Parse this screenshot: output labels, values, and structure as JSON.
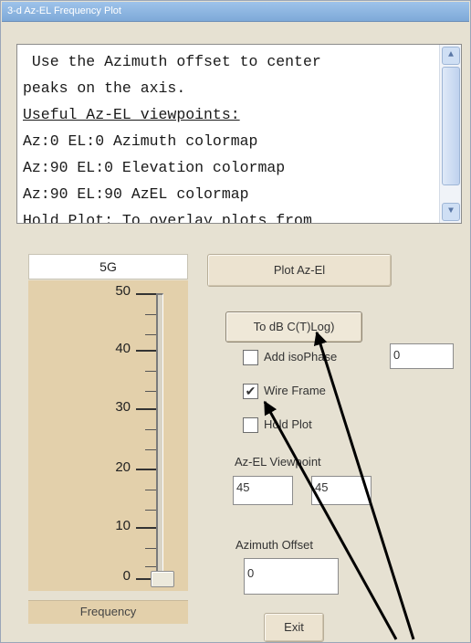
{
  "window": {
    "title": "3-d Az-EL Frequency Plot"
  },
  "info_text": {
    "lines": [
      " Use the Azimuth offset to center",
      "peaks on the axis.",
      "Useful Az-EL viewpoints:",
      "Az:0 EL:0 Azimuth colormap",
      "Az:90 EL:0 Elevation colormap",
      "Az:90 EL:90 AzEL colormap",
      "Hold Plot: To overlay plots from"
    ]
  },
  "slider": {
    "value_label": "5G",
    "caption": "Frequency",
    "ticks": [
      "50",
      "40",
      "30",
      "20",
      "10",
      "0"
    ],
    "min": 0,
    "max": 50,
    "value": 0
  },
  "buttons": {
    "plot": "Plot Az-El",
    "to_db": "To dB C(T)Log)",
    "exit": "Exit"
  },
  "checkboxes": {
    "axis_phase": {
      "label": "Add isoPhase",
      "checked": false
    },
    "wire_frame": {
      "label": "Wire Frame",
      "checked": true
    },
    "hold_plot": {
      "label": "Hold Plot",
      "checked": false
    }
  },
  "fields": {
    "axis_phase_value": "0",
    "viewpoint_label": "Az-EL Viewpoint",
    "viewpoint_az": "45",
    "viewpoint_el": "45",
    "azimuth_offset_label": "Azimuth Offset",
    "azimuth_offset_value": "0"
  },
  "colors": {
    "titlebar": "#8fb6e2",
    "background": "#e6e1d2",
    "slider_panel": "#e3d0ab",
    "arrow": "#000000"
  }
}
